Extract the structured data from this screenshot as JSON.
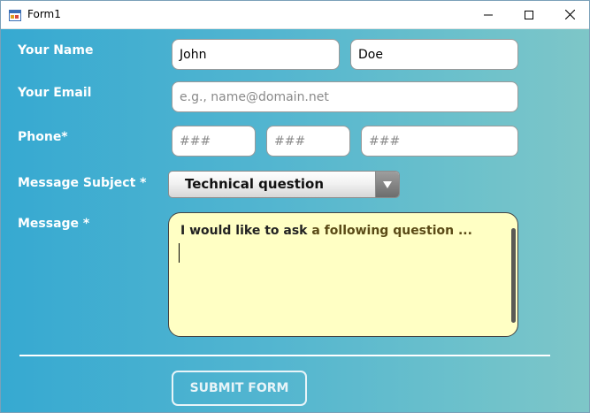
{
  "window": {
    "title": "Form1",
    "icon": "winforms-app-icon",
    "controls": [
      "minimize-icon",
      "maximize-icon",
      "close-icon"
    ]
  },
  "form": {
    "labels": {
      "name": "Your Name",
      "email": "Your Email",
      "phone": "Phone*",
      "subject": "Message Subject *",
      "message": "Message *"
    },
    "first_name": {
      "value": "John"
    },
    "last_name": {
      "value": "Doe"
    },
    "email": {
      "value": "",
      "placeholder": "e.g., name@domain.net"
    },
    "phone": [
      {
        "value": "",
        "placeholder": "###"
      },
      {
        "value": "",
        "placeholder": "###"
      },
      {
        "value": "",
        "placeholder": "###"
      }
    ],
    "subject": {
      "selected": "Technical question"
    },
    "message": {
      "text_bold": "I would like to ask",
      "text_rest": " a following question ..."
    },
    "submit_label": "SUBMIT FORM"
  },
  "colors": {
    "background_start": "#36a9d1",
    "background_end": "#7ec6c8",
    "message_bg": "#ffffc4",
    "label": "#ffffff"
  }
}
